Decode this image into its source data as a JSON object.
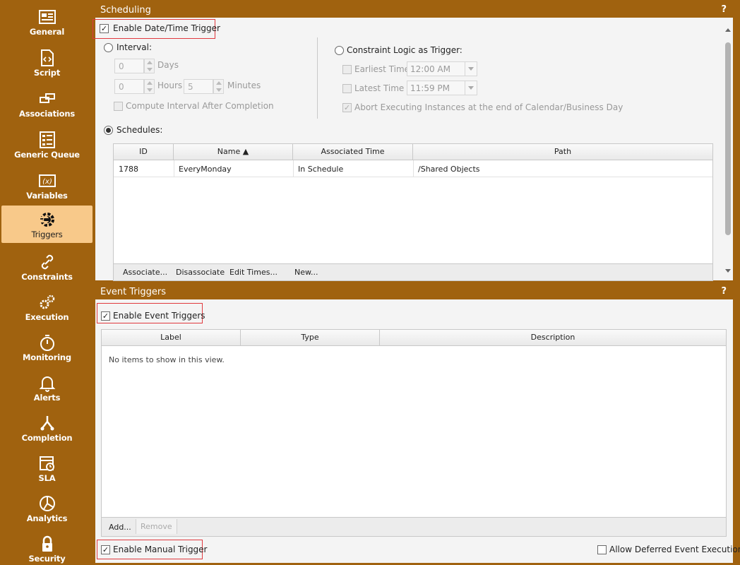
{
  "sidebar": {
    "items": [
      {
        "label": "General",
        "icon": "general-icon"
      },
      {
        "label": "Script",
        "icon": "script-icon"
      },
      {
        "label": "Associations",
        "icon": "associations-icon"
      },
      {
        "label": "Generic Queue",
        "icon": "generic-queue-icon"
      },
      {
        "label": "Variables",
        "icon": "variables-icon"
      },
      {
        "label": "Triggers",
        "icon": "triggers-icon",
        "active": true
      },
      {
        "label": "Constraints",
        "icon": "constraints-icon"
      },
      {
        "label": "Execution",
        "icon": "execution-icon"
      },
      {
        "label": "Monitoring",
        "icon": "monitoring-icon"
      },
      {
        "label": "Alerts",
        "icon": "alerts-icon"
      },
      {
        "label": "Completion",
        "icon": "completion-icon"
      },
      {
        "label": "SLA",
        "icon": "sla-icon"
      },
      {
        "label": "Analytics",
        "icon": "analytics-icon"
      },
      {
        "label": "Security",
        "icon": "security-icon"
      }
    ]
  },
  "scheduling": {
    "title": "Scheduling",
    "help": "?",
    "enable_label": "Enable Date/Time Trigger",
    "enable_checked": true,
    "interval": {
      "label": "Interval:",
      "days_value": "0",
      "days_label": "Days",
      "hours_value": "0",
      "hours_label": "Hours",
      "minutes_value": "5",
      "minutes_label": "Minutes",
      "compute_label": "Compute Interval After Completion"
    },
    "constraint": {
      "label": "Constraint Logic as Trigger:",
      "earliest_label": "Earliest Time",
      "earliest_value": "12:00 AM",
      "latest_label": "Latest Time",
      "latest_value": "11:59 PM",
      "abort_label": "Abort Executing Instances at the end of Calendar/Business Day"
    },
    "schedules_label": "Schedules:",
    "table": {
      "columns": [
        "ID",
        "Name ▲",
        "Associated Time",
        "Path"
      ],
      "rows": [
        [
          "1788",
          "EveryMonday",
          "In Schedule",
          "/Shared Objects"
        ]
      ]
    },
    "footer": [
      "Associate...",
      "Disassociate",
      "Edit Times...",
      "New..."
    ]
  },
  "event_triggers": {
    "title": "Event Triggers",
    "help": "?",
    "enable_label": "Enable Event Triggers",
    "enable_checked": true,
    "table": {
      "columns": [
        "Label",
        "Type",
        "Description"
      ],
      "empty_text": "No items to show in this view."
    },
    "footer": [
      "Add...",
      "Remove"
    ],
    "manual_label": "Enable Manual Trigger",
    "manual_checked": true,
    "deferred_label": "Allow Deferred Event Execution",
    "deferred_checked": false
  }
}
